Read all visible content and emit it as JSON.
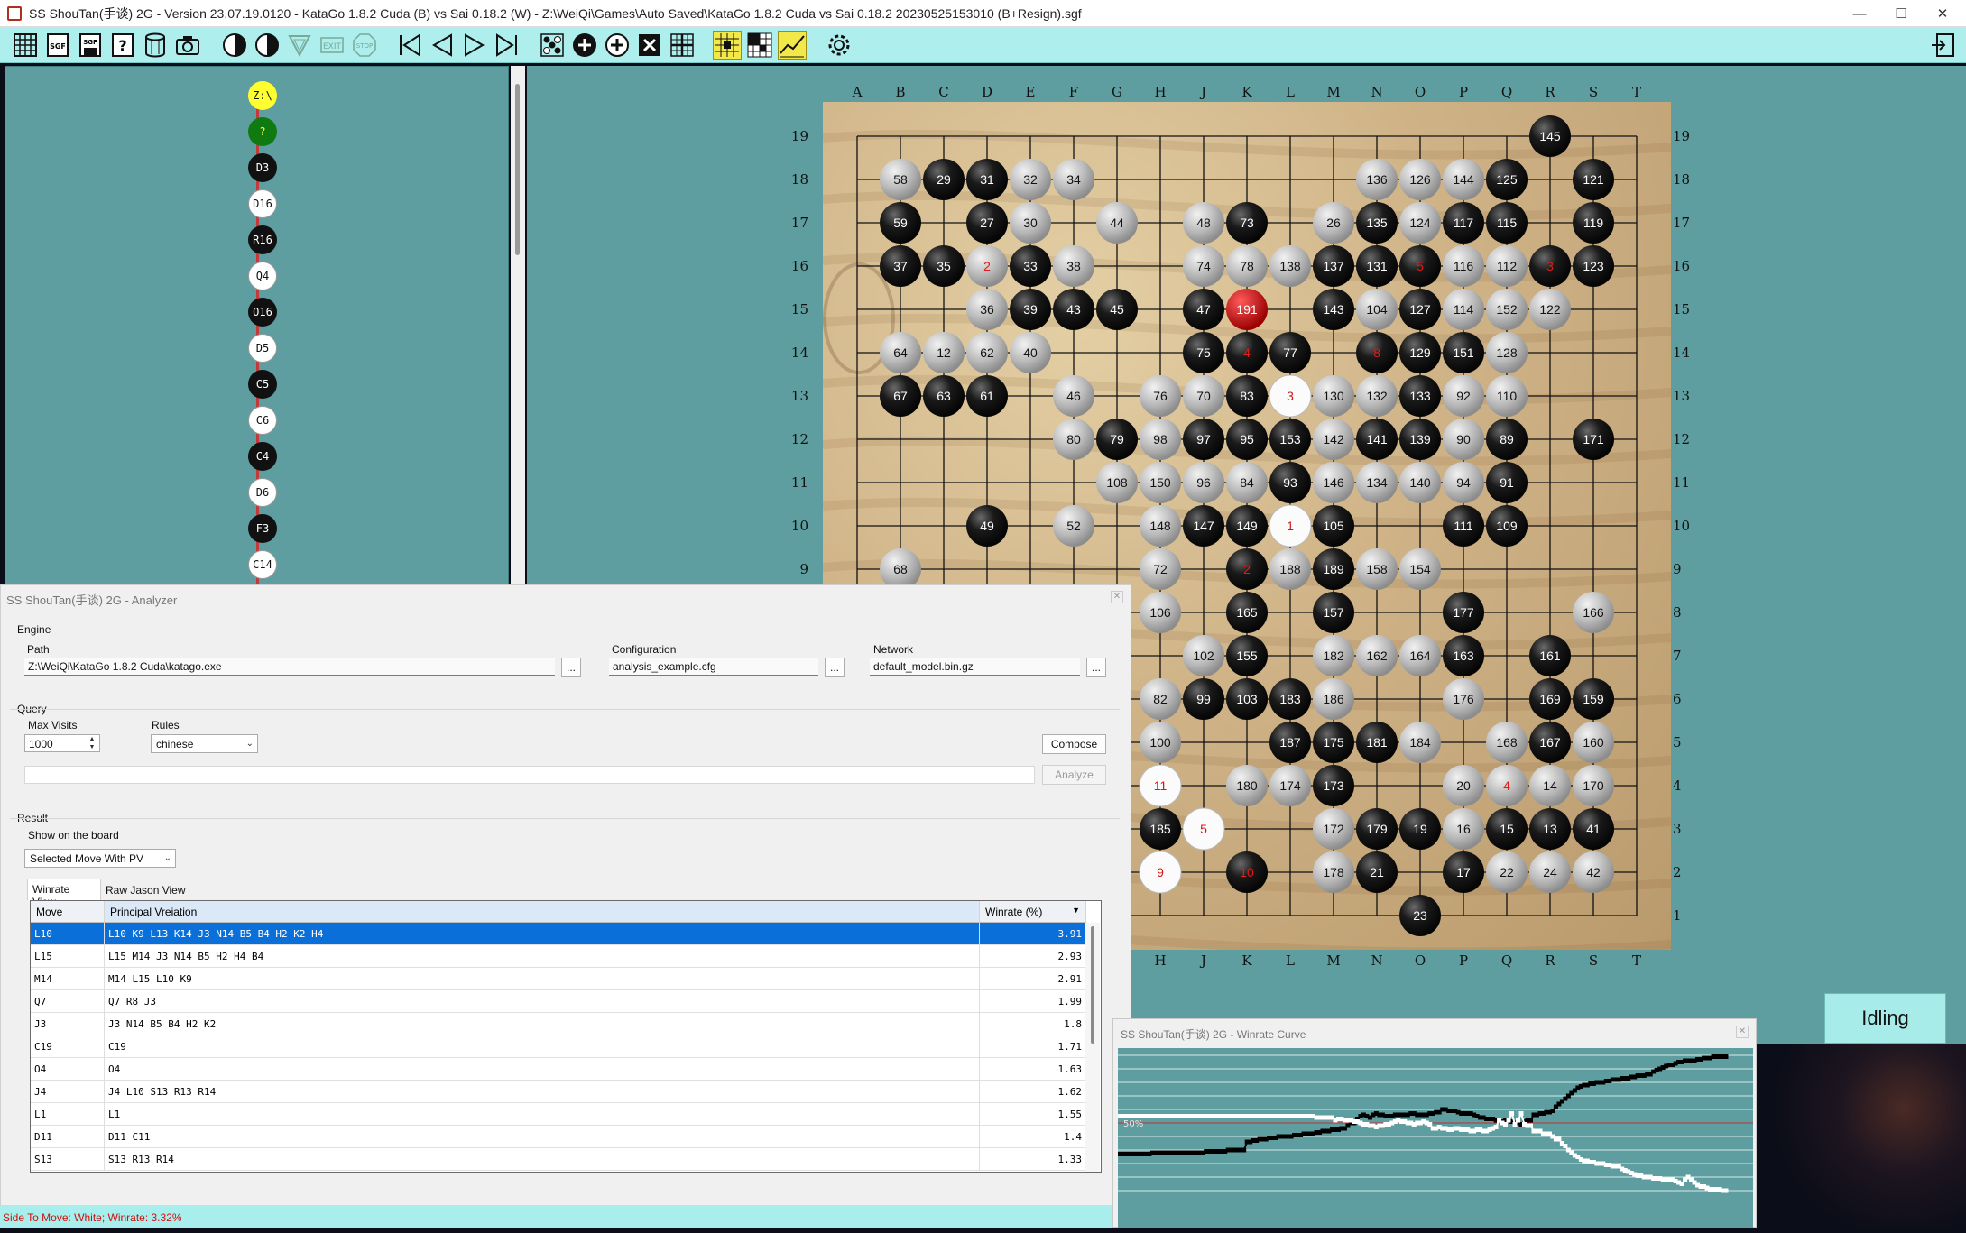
{
  "window": {
    "title": "SS ShouTan(手谈) 2G - Version 23.07.19.0120 - KataGo 1.8.2 Cuda (B) vs Sai 0.18.2 (W) - Z:\\WeiQi\\Games\\Auto Saved\\KataGo 1.8.2 Cuda vs Sai 0.18.2 20230525153010 (B+Resign).sgf",
    "controls": {
      "minimize": "—",
      "maximize": "☐",
      "close": "✕"
    }
  },
  "toolbar": {
    "items": [
      "new-board",
      "sgf-open",
      "sgf-save",
      "sgf-info",
      "database",
      "camera",
      "black-move",
      "swap-color",
      "triangle",
      "exit",
      "stop",
      "first-move",
      "previous-move",
      "next-move",
      "last-move",
      "shuffle",
      "add-stone",
      "add-move",
      "delete",
      "grid",
      "analyze-highlight",
      "territory-view",
      "winrate-graph",
      "settings",
      "dock-panel"
    ]
  },
  "tree": {
    "nodes": [
      "Z:\\",
      "?",
      "D3",
      "D16",
      "R16",
      "Q4",
      "O16",
      "D5",
      "C5",
      "C6",
      "C4",
      "D6",
      "F3",
      "C14"
    ],
    "colors": [
      "root",
      "green",
      "black",
      "white",
      "black",
      "white",
      "black",
      "white",
      "black",
      "white",
      "black",
      "white",
      "black",
      "white"
    ]
  },
  "board": {
    "columns": [
      "A",
      "B",
      "C",
      "D",
      "E",
      "F",
      "G",
      "H",
      "J",
      "K",
      "L",
      "M",
      "N",
      "O",
      "P",
      "Q",
      "R",
      "S",
      "T"
    ],
    "rows": [
      "19",
      "18",
      "17",
      "16",
      "15",
      "14",
      "13",
      "12",
      "11",
      "10",
      "9",
      "8",
      "7",
      "6",
      "5",
      "4",
      "3",
      "2",
      "1"
    ],
    "last_move": "191",
    "stones": [
      [
        "R19",
        "b",
        "145"
      ],
      [
        "B18",
        "w",
        "58"
      ],
      [
        "C18",
        "b",
        "29"
      ],
      [
        "D18",
        "b",
        "31"
      ],
      [
        "E18",
        "w",
        "32"
      ],
      [
        "F18",
        "w",
        "34"
      ],
      [
        "N18",
        "w",
        "136"
      ],
      [
        "O18",
        "w",
        "126"
      ],
      [
        "P18",
        "w",
        "144"
      ],
      [
        "Q18",
        "b",
        "125"
      ],
      [
        "S18",
        "b",
        "121"
      ],
      [
        "B17",
        "b",
        "59"
      ],
      [
        "D17",
        "b",
        "27"
      ],
      [
        "E17",
        "w",
        "30"
      ],
      [
        "G17",
        "w",
        "44"
      ],
      [
        "J17",
        "w",
        "48"
      ],
      [
        "K17",
        "b",
        "73"
      ],
      [
        "M17",
        "w",
        "26"
      ],
      [
        "N17",
        "b",
        "135"
      ],
      [
        "O17",
        "w",
        "124"
      ],
      [
        "P17",
        "b",
        "117"
      ],
      [
        "Q17",
        "b",
        "115"
      ],
      [
        "S17",
        "b",
        "119"
      ],
      [
        "B16",
        "b",
        "37"
      ],
      [
        "C16",
        "b",
        "35"
      ],
      [
        "D16",
        "w",
        "2"
      ],
      [
        "E16",
        "b",
        "33"
      ],
      [
        "F16",
        "w",
        "38"
      ],
      [
        "J16",
        "w",
        "74"
      ],
      [
        "K16",
        "w",
        "78"
      ],
      [
        "L16",
        "w",
        "138"
      ],
      [
        "M16",
        "b",
        "137"
      ],
      [
        "N16",
        "b",
        "131"
      ],
      [
        "O16",
        "b",
        "5"
      ],
      [
        "P16",
        "w",
        "116"
      ],
      [
        "Q16",
        "w",
        "112"
      ],
      [
        "R16",
        "b",
        "3"
      ],
      [
        "S16",
        "b",
        "123"
      ],
      [
        "D15",
        "w",
        "36"
      ],
      [
        "E15",
        "b",
        "39"
      ],
      [
        "F15",
        "b",
        "43"
      ],
      [
        "G15",
        "b",
        "45"
      ],
      [
        "J15",
        "b",
        "47"
      ],
      [
        "K15",
        "r",
        "191"
      ],
      [
        "M15",
        "b",
        "143"
      ],
      [
        "N15",
        "w",
        "104"
      ],
      [
        "O15",
        "b",
        "127"
      ],
      [
        "P15",
        "w",
        "114"
      ],
      [
        "Q15",
        "w",
        "152"
      ],
      [
        "R15",
        "w",
        "122"
      ],
      [
        "B14",
        "w",
        "64"
      ],
      [
        "C14",
        "w",
        "12"
      ],
      [
        "D14",
        "w",
        "62"
      ],
      [
        "E14",
        "w",
        "40"
      ],
      [
        "J14",
        "b",
        "75"
      ],
      [
        "K14",
        "b",
        "4"
      ],
      [
        "L14",
        "b",
        "77"
      ],
      [
        "N14",
        "b",
        "8"
      ],
      [
        "O14",
        "b",
        "129"
      ],
      [
        "P14",
        "b",
        "151"
      ],
      [
        "Q14",
        "w",
        "128"
      ],
      [
        "B13",
        "b",
        "67"
      ],
      [
        "C13",
        "b",
        "63"
      ],
      [
        "D13",
        "b",
        "61"
      ],
      [
        "F13",
        "w",
        "46"
      ],
      [
        "H13",
        "w",
        "76"
      ],
      [
        "J13",
        "w",
        "70"
      ],
      [
        "K13",
        "b",
        "83"
      ],
      [
        "L13",
        "x",
        "3"
      ],
      [
        "M13",
        "w",
        "130"
      ],
      [
        "N13",
        "w",
        "132"
      ],
      [
        "O13",
        "b",
        "133"
      ],
      [
        "P13",
        "w",
        "92"
      ],
      [
        "Q13",
        "w",
        "110"
      ],
      [
        "F12",
        "w",
        "80"
      ],
      [
        "G12",
        "b",
        "79"
      ],
      [
        "H12",
        "w",
        "98"
      ],
      [
        "J12",
        "b",
        "97"
      ],
      [
        "K12",
        "b",
        "95"
      ],
      [
        "L12",
        "b",
        "153"
      ],
      [
        "M12",
        "w",
        "142"
      ],
      [
        "N12",
        "b",
        "141"
      ],
      [
        "O12",
        "b",
        "139"
      ],
      [
        "P12",
        "w",
        "90"
      ],
      [
        "Q12",
        "b",
        "89"
      ],
      [
        "S12",
        "b",
        "171"
      ],
      [
        "G11",
        "w",
        "108"
      ],
      [
        "H11",
        "w",
        "150"
      ],
      [
        "J11",
        "w",
        "96"
      ],
      [
        "K11",
        "w",
        "84"
      ],
      [
        "L11",
        "b",
        "93"
      ],
      [
        "M11",
        "w",
        "146"
      ],
      [
        "N11",
        "w",
        "134"
      ],
      [
        "O11",
        "w",
        "140"
      ],
      [
        "P11",
        "w",
        "94"
      ],
      [
        "Q11",
        "b",
        "91"
      ],
      [
        "D10",
        "b",
        "49"
      ],
      [
        "F10",
        "w",
        "52"
      ],
      [
        "H10",
        "w",
        "148"
      ],
      [
        "J10",
        "b",
        "147"
      ],
      [
        "K10",
        "b",
        "149"
      ],
      [
        "L10",
        "x",
        "1"
      ],
      [
        "M10",
        "b",
        "105"
      ],
      [
        "P10",
        "b",
        "111"
      ],
      [
        "Q10",
        "b",
        "109"
      ],
      [
        "B9",
        "w",
        "68"
      ],
      [
        "H9",
        "w",
        "72"
      ],
      [
        "K9",
        "b",
        "2"
      ],
      [
        "L9",
        "w",
        "188"
      ],
      [
        "M9",
        "b",
        "189"
      ],
      [
        "N9",
        "w",
        "158"
      ],
      [
        "O9",
        "w",
        "154"
      ],
      [
        "H8",
        "w",
        "106"
      ],
      [
        "K8",
        "b",
        "165"
      ],
      [
        "M8",
        "b",
        "157"
      ],
      [
        "P8",
        "b",
        "177"
      ],
      [
        "S8",
        "w",
        "166"
      ],
      [
        "J7",
        "w",
        "102"
      ],
      [
        "K7",
        "b",
        "155"
      ],
      [
        "M7",
        "w",
        "182"
      ],
      [
        "N7",
        "w",
        "162"
      ],
      [
        "O7",
        "w",
        "164"
      ],
      [
        "P7",
        "b",
        "163"
      ],
      [
        "R7",
        "b",
        "161"
      ],
      [
        "H6",
        "w",
        "82"
      ],
      [
        "J6",
        "b",
        "99"
      ],
      [
        "K6",
        "b",
        "103"
      ],
      [
        "L6",
        "b",
        "183"
      ],
      [
        "M6",
        "w",
        "186"
      ],
      [
        "P6",
        "w",
        "176"
      ],
      [
        "R6",
        "b",
        "169"
      ],
      [
        "S6",
        "b",
        "159"
      ],
      [
        "H5",
        "w",
        "100"
      ],
      [
        "L5",
        "b",
        "187"
      ],
      [
        "M5",
        "b",
        "175"
      ],
      [
        "N5",
        "b",
        "181"
      ],
      [
        "O5",
        "w",
        "184"
      ],
      [
        "Q5",
        "w",
        "168"
      ],
      [
        "R5",
        "b",
        "167"
      ],
      [
        "S5",
        "w",
        "160"
      ],
      [
        "H4",
        "x",
        "11"
      ],
      [
        "K4",
        "w",
        "180"
      ],
      [
        "L4",
        "w",
        "174"
      ],
      [
        "M4",
        "b",
        "173"
      ],
      [
        "P4",
        "w",
        "20"
      ],
      [
        "Q4",
        "w",
        "4"
      ],
      [
        "R4",
        "w",
        "14"
      ],
      [
        "S4",
        "w",
        "170"
      ],
      [
        "H3",
        "b",
        "185"
      ],
      [
        "J3",
        "x",
        "5"
      ],
      [
        "M3",
        "w",
        "172"
      ],
      [
        "N3",
        "b",
        "179"
      ],
      [
        "O3",
        "b",
        "19"
      ],
      [
        "P3",
        "w",
        "16"
      ],
      [
        "Q3",
        "b",
        "15"
      ],
      [
        "R3",
        "b",
        "13"
      ],
      [
        "S3",
        "b",
        "41"
      ],
      [
        "H2",
        "x",
        "9"
      ],
      [
        "K2",
        "b",
        "10"
      ],
      [
        "M2",
        "w",
        "178"
      ],
      [
        "N2",
        "b",
        "21"
      ],
      [
        "P2",
        "b",
        "17"
      ],
      [
        "Q2",
        "w",
        "22"
      ],
      [
        "R2",
        "w",
        "24"
      ],
      [
        "S2",
        "w",
        "42"
      ],
      [
        "O1",
        "b",
        "23"
      ]
    ],
    "red_numbers": [
      "191",
      "4",
      "8",
      "3",
      "1",
      "2",
      "11",
      "5",
      "9",
      "10"
    ]
  },
  "analyzer": {
    "title": "SS ShouTan(手谈) 2G - Analyzer",
    "engine_label": "Engine",
    "path_label": "Path",
    "path_value": "Z:\\WeiQi\\KataGo 1.8.2 Cuda\\katago.exe",
    "config_label": "Configuration",
    "config_value": "analysis_example.cfg",
    "network_label": "Network",
    "network_value": "default_model.bin.gz",
    "browse": "...",
    "query_label": "Query",
    "max_visits_label": "Max Visits",
    "max_visits_value": "1000",
    "rules_label": "Rules",
    "rules_value": "chinese",
    "compose": "Compose",
    "analyze": "Analyze",
    "query_text": "",
    "result_label": "Result",
    "show_label": "Show on the board",
    "show_value": "Selected Move With PV",
    "tab_winrate": "Winrate View",
    "tab_json": "Raw Jason View",
    "columns": {
      "move": "Move",
      "pv": "Principal Vreiation",
      "winrate": "Winrate (%)"
    },
    "rows": [
      {
        "move": "L10",
        "pv": "L10 K9 L13 K14 J3 N14 B5 B4 H2 K2 H4",
        "winrate": "3.91"
      },
      {
        "move": "L15",
        "pv": "L15 M14 J3 N14 B5 H2 H4 B4",
        "winrate": "2.93"
      },
      {
        "move": "M14",
        "pv": "M14 L15 L10 K9",
        "winrate": "2.91"
      },
      {
        "move": "Q7",
        "pv": "Q7 R8 J3",
        "winrate": "1.99"
      },
      {
        "move": "J3",
        "pv": "J3 N14 B5 B4 H2 K2",
        "winrate": "1.8"
      },
      {
        "move": "C19",
        "pv": "C19",
        "winrate": "1.71"
      },
      {
        "move": "O4",
        "pv": "O4",
        "winrate": "1.63"
      },
      {
        "move": "J4",
        "pv": "J4 L10 S13 R13 R14",
        "winrate": "1.62"
      },
      {
        "move": "L1",
        "pv": "L1",
        "winrate": "1.55"
      },
      {
        "move": "D11",
        "pv": "D11 C11",
        "winrate": "1.4"
      },
      {
        "move": "S13",
        "pv": "S13 R13 R14",
        "winrate": "1.33"
      }
    ],
    "status": "Side To Move: White; Winrate: 3.32%"
  },
  "winrate_window": {
    "title": "SS ShouTan(手谈) 2G - Winrate Curve",
    "mid_label": "50%",
    "black_series": [
      27,
      27,
      27,
      27,
      27,
      27,
      27,
      27,
      27,
      27,
      27,
      28,
      28,
      28,
      28,
      28,
      28,
      28,
      28,
      28,
      28,
      28,
      28,
      28,
      28,
      28,
      28,
      28,
      29,
      29,
      29,
      29,
      29,
      29,
      29,
      30,
      30,
      30,
      30,
      30,
      30,
      36,
      36,
      37,
      37,
      38,
      38,
      38,
      39,
      39,
      39,
      40,
      40,
      40,
      40,
      40,
      41,
      41,
      41,
      42,
      42,
      42,
      42,
      43,
      43,
      44,
      44,
      44,
      45,
      45,
      45,
      46,
      46,
      48,
      50,
      50,
      53,
      55,
      56,
      55,
      54,
      56,
      57,
      56,
      56,
      55,
      55,
      55,
      56,
      56,
      56,
      56,
      56,
      57,
      57,
      56,
      56,
      56,
      56,
      57,
      57,
      58,
      58,
      60,
      60,
      59,
      59,
      59,
      58,
      57,
      57,
      57,
      57,
      56,
      55,
      54,
      54,
      53,
      53,
      53,
      52,
      52,
      51,
      52,
      52,
      51,
      50,
      50,
      49,
      51,
      52,
      52,
      56,
      56,
      57,
      57,
      58,
      58,
      59,
      62,
      64,
      66,
      68,
      70,
      72,
      74,
      76,
      77,
      78,
      78,
      79,
      79,
      80,
      80,
      80,
      81,
      81,
      82,
      82,
      82,
      83,
      83,
      83,
      84,
      84,
      85,
      85,
      85,
      86,
      86,
      88,
      89,
      90,
      91,
      92,
      93,
      93,
      94,
      95,
      95,
      96,
      96,
      96,
      96,
      97,
      97,
      98,
      98,
      98,
      99,
      99,
      99,
      99,
      99
    ],
    "white_series": [
      55,
      55,
      55,
      55,
      55,
      55,
      55,
      55,
      55,
      55,
      55,
      55,
      55,
      55,
      55,
      55,
      55,
      55,
      55,
      55,
      55,
      55,
      55,
      55,
      55,
      55,
      55,
      55,
      55,
      55,
      55,
      55,
      55,
      55,
      55,
      55,
      55,
      55,
      55,
      55,
      55,
      55,
      55,
      55,
      55,
      55,
      55,
      55,
      55,
      55,
      55,
      55,
      55,
      55,
      55,
      55,
      55,
      55,
      55,
      55,
      55,
      55,
      55,
      54,
      54,
      54,
      54,
      54,
      54,
      52,
      53,
      53,
      52,
      52,
      52,
      51,
      51,
      50,
      49,
      49,
      48,
      48,
      47,
      48,
      48,
      49,
      49,
      50,
      51,
      52,
      51,
      51,
      50,
      50,
      49,
      50,
      50,
      51,
      50,
      49,
      46,
      46,
      47,
      46,
      46,
      45,
      45,
      46,
      46,
      45,
      45,
      45,
      44,
      44,
      45,
      45,
      44,
      44,
      45,
      46,
      47,
      52,
      50,
      49,
      52,
      57,
      49,
      52,
      57,
      49,
      48,
      48,
      44,
      44,
      44,
      42,
      42,
      42,
      40,
      38,
      38,
      35,
      33,
      30,
      28,
      26,
      25,
      23,
      22,
      22,
      21,
      21,
      20,
      20,
      20,
      19,
      19,
      18,
      18,
      18,
      16,
      15,
      14,
      13,
      12,
      11,
      11,
      10,
      10,
      10,
      9,
      9,
      9,
      8,
      8,
      8,
      8,
      7,
      6,
      5,
      8,
      10,
      8,
      6,
      4,
      3,
      3,
      2,
      1,
      1,
      1,
      1,
      0,
      0
    ]
  },
  "idle_label": "Idling"
}
